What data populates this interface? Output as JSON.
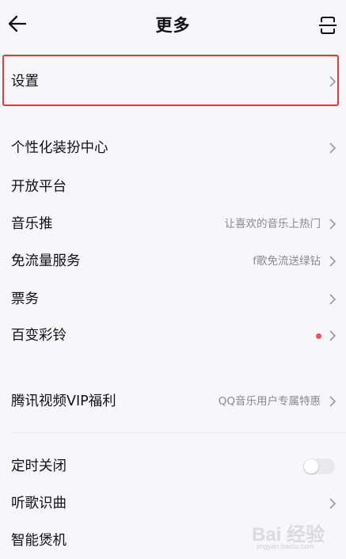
{
  "header": {
    "title": "更多",
    "back_icon": "back-arrow-icon",
    "scan_icon": "scan-icon"
  },
  "rows": {
    "settings": {
      "label": "设置"
    },
    "personalization": {
      "label": "个性化装扮中心"
    },
    "open_platform": {
      "label": "开放平台"
    },
    "music_promo": {
      "label": "音乐推",
      "value": "让喜欢的音乐上热门"
    },
    "free_data": {
      "label": "免流量服务",
      "value": "听歌免流送绿钻",
      "visible_value": "f歌免流送绿钻"
    },
    "tickets": {
      "label": "票务"
    },
    "ringtones": {
      "label": "百变彩铃",
      "has_red_dot": true
    },
    "tencent_vip": {
      "label": "腾讯视频VIP福利",
      "value": "QQ音乐用户专属特惠"
    },
    "sleep_timer": {
      "label": "定时关闭",
      "toggle_on": false
    },
    "song_recognition": {
      "label": "听歌识曲"
    },
    "smart_device": {
      "label": "智能煲机"
    }
  },
  "colors": {
    "background": "#f7f7f9",
    "highlight_border": "#e53935",
    "red_dot": "#ff4d4f",
    "secondary_text": "#8a8a8a"
  },
  "watermark": {
    "text": "Bai 经验",
    "sub": "jingyan.baidu.com"
  }
}
